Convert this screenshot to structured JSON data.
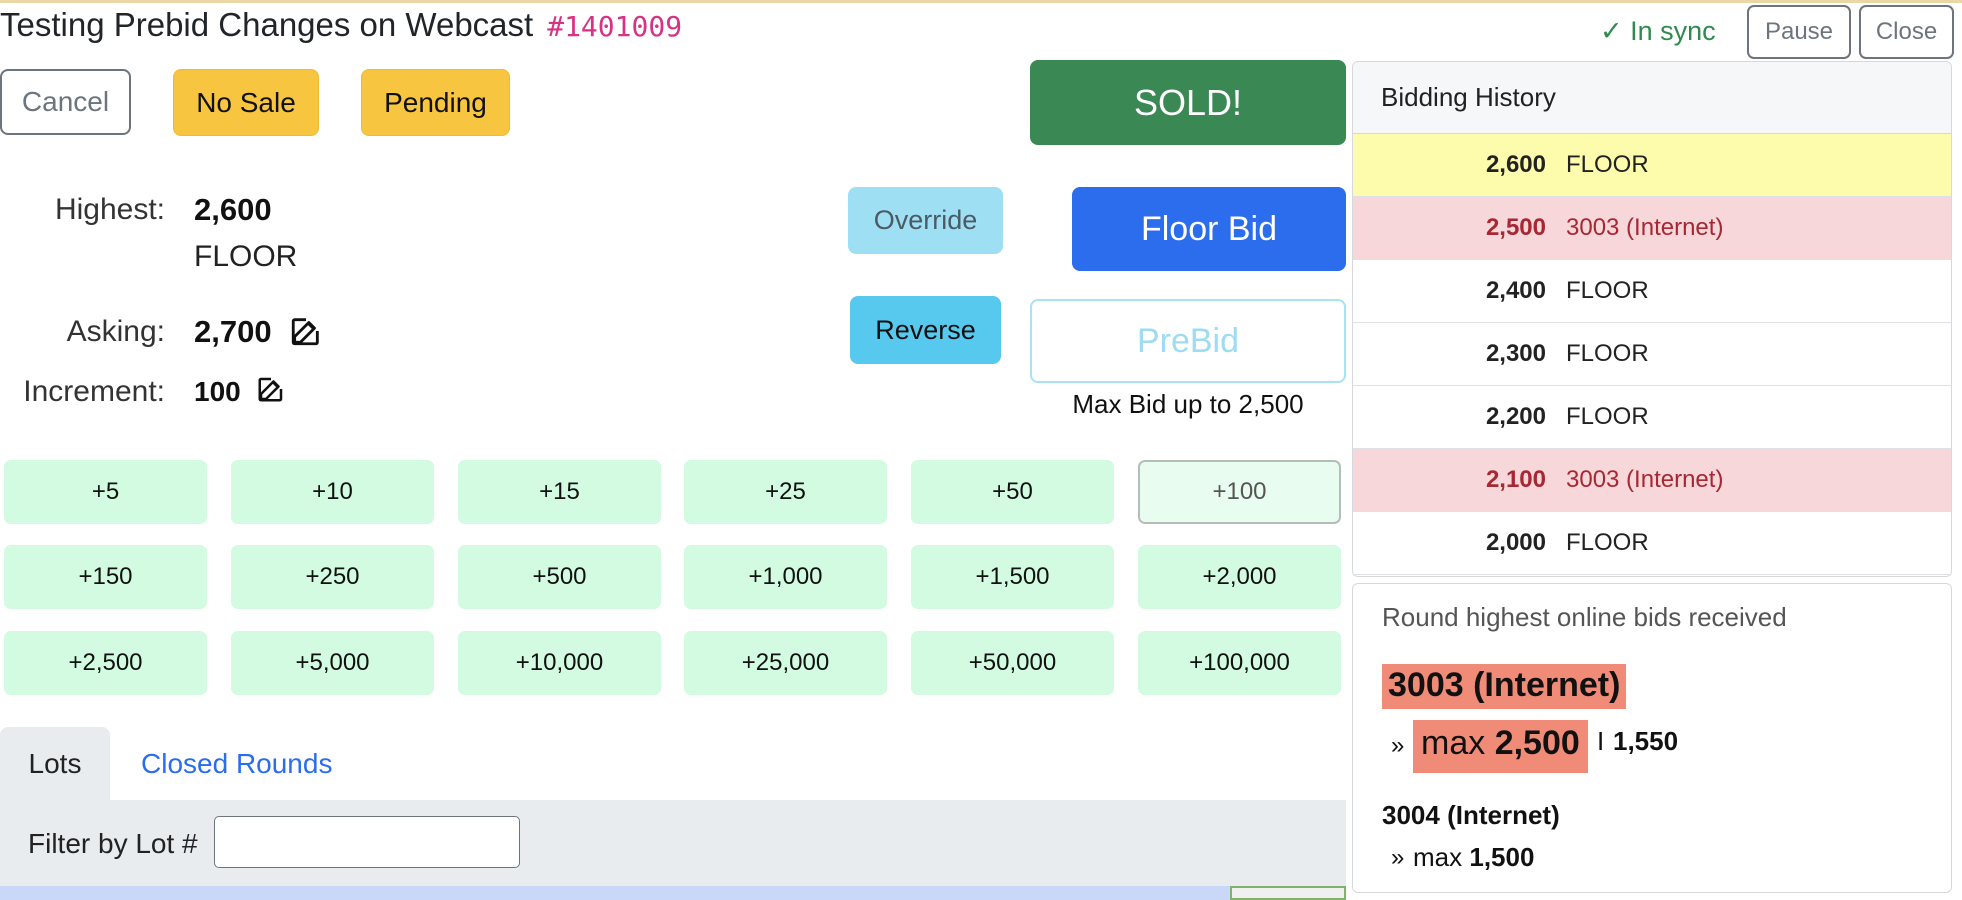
{
  "header": {
    "title": "Testing Prebid Changes on Webcast",
    "code": "#1401009",
    "sync_status": "✓ In sync",
    "pause_label": "Pause",
    "close_label": "Close"
  },
  "actions": {
    "cancel_label": "Cancel",
    "no_sale_label": "No Sale",
    "pending_label": "Pending",
    "sold_label": "SOLD!",
    "override_label": "Override",
    "reverse_label": "Reverse",
    "floor_bid_label": "Floor Bid",
    "prebid_label": "PreBid",
    "max_bid_note": "Max Bid up to 2,500"
  },
  "status": {
    "highest_label": "Highest:",
    "highest_value": "2,600",
    "highest_source": "FLOOR",
    "asking_label": "Asking:",
    "asking_value": "2,700",
    "increment_label": "Increment:",
    "increment_value": "100"
  },
  "increments": [
    [
      "+5",
      "+10",
      "+15",
      "+25",
      "+50",
      "+100"
    ],
    [
      "+150",
      "+250",
      "+500",
      "+1,000",
      "+1,500",
      "+2,000"
    ],
    [
      "+2,500",
      "+5,000",
      "+10,000",
      "+25,000",
      "+50,000",
      "+100,000"
    ]
  ],
  "selected_increment": "+100",
  "tabs": {
    "lots_label": "Lots",
    "closed_rounds_label": "Closed Rounds"
  },
  "filter": {
    "label": "Filter by Lot #",
    "value": ""
  },
  "history": {
    "title": "Bidding History",
    "rows": [
      {
        "amount": "2,600",
        "bidder": "FLOOR",
        "state": "highest"
      },
      {
        "amount": "2,500",
        "bidder": "3003 (Internet)",
        "state": "internet"
      },
      {
        "amount": "2,400",
        "bidder": "FLOOR",
        "state": "normal"
      },
      {
        "amount": "2,300",
        "bidder": "FLOOR",
        "state": "normal"
      },
      {
        "amount": "2,200",
        "bidder": "FLOOR",
        "state": "normal"
      },
      {
        "amount": "2,100",
        "bidder": "3003 (Internet)",
        "state": "internet"
      },
      {
        "amount": "2,000",
        "bidder": "FLOOR",
        "state": "normal"
      }
    ]
  },
  "online_bids": {
    "title": "Round highest online bids received",
    "first_bidder": "3003 (Internet)",
    "first_max_prefix": "max",
    "first_max_value": "2,500",
    "first_separator": "I",
    "first_alt_value": "1,550",
    "second_bidder": "3004 (Internet)",
    "second_max_prefix": "max",
    "second_max_value": "1,500",
    "arrow": "»"
  },
  "colors": {
    "sold": "#3a8853",
    "floor_bid": "#2b6ded",
    "yellow": "#f8c540",
    "increment_bg": "#d2fbe1",
    "highlight_row": "#fdfcad",
    "internet_row": "#f8d7da",
    "online_highlight": "#f08b78",
    "code_pink": "#d63384"
  }
}
